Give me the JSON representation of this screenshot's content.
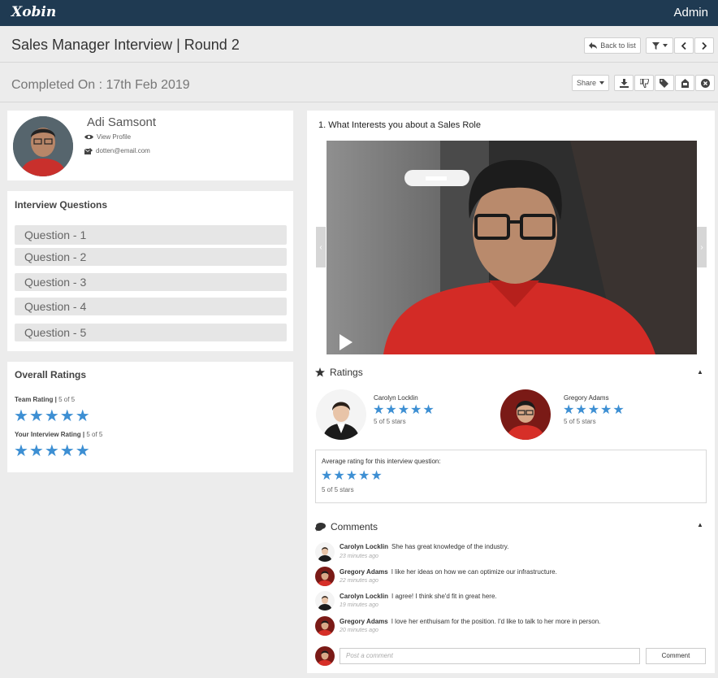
{
  "header": {
    "brand": "Xobin",
    "user": "Admin"
  },
  "page": {
    "title": "Sales Manager Interview | Round 2",
    "completed": "Completed On : 17th Feb 2019"
  },
  "toolbar": {
    "back_label": "Back to list",
    "share_label": "Share"
  },
  "candidate": {
    "name": "Adi Samsont",
    "view_profile": "View Profile",
    "email": "dotten@email.com"
  },
  "questions_panel": {
    "title": "Interview Questions",
    "items": [
      "Question - 1",
      "Question - 2",
      "Question - 3",
      "Question - 4",
      "Question - 5"
    ]
  },
  "overall": {
    "title": "Overall Ratings",
    "team_label": "Team Rating",
    "team_value": "5 of 5",
    "team_stars": 5,
    "your_label": "Your Interview Rating",
    "your_value": "5 of 5",
    "your_stars": 5
  },
  "question": {
    "heading": "1.  What Interests you about a Sales Role"
  },
  "ratings": {
    "title": "Ratings",
    "raters": [
      {
        "name": "Carolyn Locklin",
        "stars": 5,
        "score": "5 of 5 stars"
      },
      {
        "name": "Gregory Adams",
        "stars": 5,
        "score": "5 of 5 stars"
      }
    ],
    "average_title": "Average rating for this interview question:",
    "average_stars": 5,
    "average_score": "5 of 5 stars"
  },
  "comments": {
    "title": "Comments",
    "items": [
      {
        "author": "Carolyn Locklin",
        "text": "She has great knowledge of the industry.",
        "time": "23 minutes ago"
      },
      {
        "author": "Gregory Adams",
        "text": "I like her ideas on how we can optimize our infrastructure.",
        "time": "22 minutes ago"
      },
      {
        "author": "Carolyn Locklin",
        "text": "I agree! I think she'd fit in great here.",
        "time": "19 minutes ago"
      },
      {
        "author": "Gregory Adams",
        "text": "I love her enthuisam for the position. I'd like to talk to her more in person.",
        "time": "20 minutes ago"
      }
    ],
    "placeholder": "Post a comment",
    "button_label": "Comment"
  },
  "colors": {
    "topbar": "#1f3a52",
    "star": "#3d8fd3"
  }
}
